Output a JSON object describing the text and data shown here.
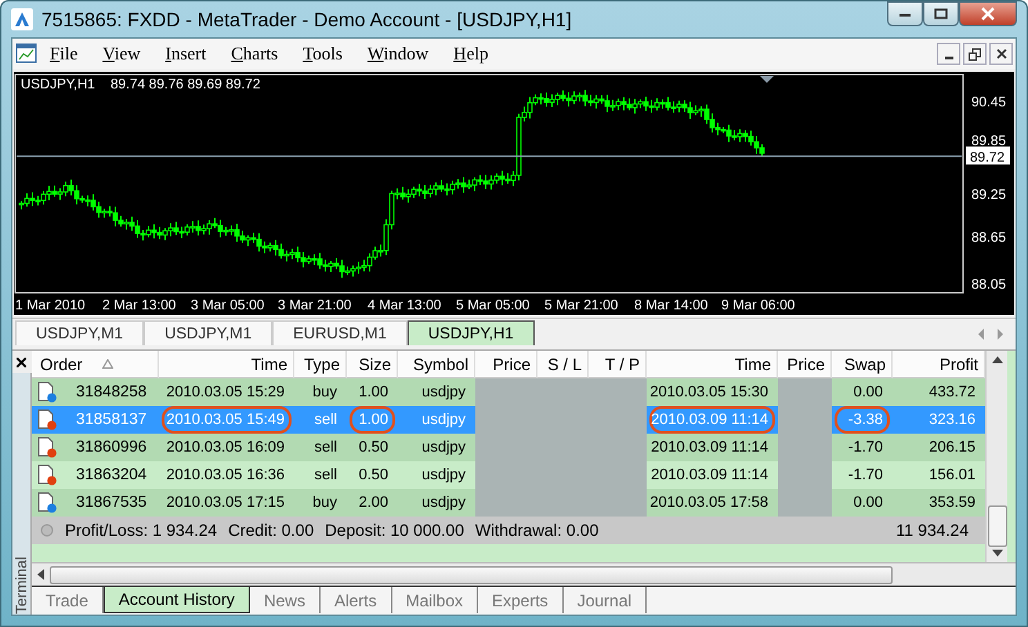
{
  "window": {
    "title": "7515865: FXDD - MetaTrader - Demo Account - [USDJPY,H1]"
  },
  "menu": [
    "File",
    "View",
    "Insert",
    "Charts",
    "Tools",
    "Window",
    "Help"
  ],
  "chart": {
    "symbol": "USDJPY,H1",
    "ohlc": "89.74 89.76 89.69 89.72",
    "y_labels": [
      "90.45",
      "89.85",
      "89.25",
      "88.65",
      "88.05"
    ],
    "current_price": "89.72",
    "x_labels": [
      "1 Mar 2010",
      "2 Mar 13:00",
      "3 Mar 05:00",
      "3 Mar 21:00",
      "4 Mar 13:00",
      "5 Mar 05:00",
      "5 Mar 21:00",
      "8 Mar 14:00",
      "9 Mar 06:00"
    ]
  },
  "chart_tabs": [
    {
      "label": "USDJPY,M1",
      "selected": false
    },
    {
      "label": "USDJPY,M1",
      "selected": false
    },
    {
      "label": "EURUSD,M1",
      "selected": false
    },
    {
      "label": "USDJPY,H1",
      "selected": true
    }
  ],
  "terminal": {
    "title": "Terminal",
    "columns": [
      {
        "label": "Order",
        "sorted": true,
        "redacted": false
      },
      {
        "label": "Time",
        "sorted": false,
        "redacted": false
      },
      {
        "label": "Type",
        "sorted": false,
        "redacted": false
      },
      {
        "label": "Size",
        "sorted": false,
        "redacted": false
      },
      {
        "label": "Symbol",
        "sorted": false,
        "redacted": false
      },
      {
        "label": "Price",
        "sorted": false,
        "redacted": true
      },
      {
        "label": "S / L",
        "sorted": false,
        "redacted": true
      },
      {
        "label": "T / P",
        "sorted": false,
        "redacted": true
      },
      {
        "label": "Time",
        "sorted": false,
        "redacted": false
      },
      {
        "label": "Price",
        "sorted": false,
        "redacted": true
      },
      {
        "label": "Swap",
        "sorted": false,
        "redacted": false
      },
      {
        "label": "Profit",
        "sorted": false,
        "redacted": false
      }
    ],
    "rows": [
      {
        "kind": "buy",
        "selected": false,
        "cells": [
          {
            "text": "31848258",
            "circled": false
          },
          {
            "text": "2010.03.05 15:29",
            "circled": false
          },
          {
            "text": "buy",
            "circled": false
          },
          {
            "text": "1.00",
            "circled": false
          },
          {
            "text": "usdjpy",
            "circled": false
          },
          {
            "text": "2010.03.05 15:30",
            "circled": false
          },
          {
            "text": "0.00",
            "circled": false
          },
          {
            "text": "433.72",
            "circled": false
          }
        ]
      },
      {
        "kind": "sell",
        "selected": true,
        "cells": [
          {
            "text": "31858137",
            "circled": false
          },
          {
            "text": "2010.03.05 15:49",
            "circled": true
          },
          {
            "text": "sell",
            "circled": false
          },
          {
            "text": "1.00",
            "circled": true
          },
          {
            "text": "usdjpy",
            "circled": false
          },
          {
            "text": "2010.03.09 11:14",
            "circled": true
          },
          {
            "text": "-3.38",
            "circled": true
          },
          {
            "text": "323.16",
            "circled": false
          }
        ]
      },
      {
        "kind": "sell",
        "selected": false,
        "cells": [
          {
            "text": "31860996",
            "circled": false
          },
          {
            "text": "2010.03.05 16:09",
            "circled": false
          },
          {
            "text": "sell",
            "circled": false
          },
          {
            "text": "0.50",
            "circled": false
          },
          {
            "text": "usdjpy",
            "circled": false
          },
          {
            "text": "2010.03.09 11:14",
            "circled": false
          },
          {
            "text": "-1.70",
            "circled": false
          },
          {
            "text": "206.15",
            "circled": false
          }
        ]
      },
      {
        "kind": "sell",
        "selected": false,
        "cells": [
          {
            "text": "31863204",
            "circled": false
          },
          {
            "text": "2010.03.05 16:36",
            "circled": false
          },
          {
            "text": "sell",
            "circled": false
          },
          {
            "text": "0.50",
            "circled": false
          },
          {
            "text": "usdjpy",
            "circled": false
          },
          {
            "text": "2010.03.09 11:14",
            "circled": false
          },
          {
            "text": "-1.70",
            "circled": false
          },
          {
            "text": "156.01",
            "circled": false
          }
        ]
      },
      {
        "kind": "buy",
        "selected": false,
        "cells": [
          {
            "text": "31867535",
            "circled": false
          },
          {
            "text": "2010.03.05 17:15",
            "circled": false
          },
          {
            "text": "buy",
            "circled": false
          },
          {
            "text": "2.00",
            "circled": false
          },
          {
            "text": "usdjpy",
            "circled": false
          },
          {
            "text": "2010.03.05 17:58",
            "circled": false
          },
          {
            "text": "0.00",
            "circled": false
          },
          {
            "text": "353.59",
            "circled": false
          }
        ]
      }
    ],
    "summary": {
      "items": [
        "Profit/Loss: 1 934.24",
        "Credit: 0.00",
        "Deposit: 10 000.00",
        "Withdrawal: 0.00"
      ],
      "total": "11 934.24"
    },
    "tabs": [
      {
        "label": "Trade",
        "selected": false
      },
      {
        "label": "Account History",
        "selected": true
      },
      {
        "label": "News",
        "selected": false
      },
      {
        "label": "Alerts",
        "selected": false
      },
      {
        "label": "Mailbox",
        "selected": false
      },
      {
        "label": "Experts",
        "selected": false
      },
      {
        "label": "Journal",
        "selected": false
      }
    ]
  }
}
